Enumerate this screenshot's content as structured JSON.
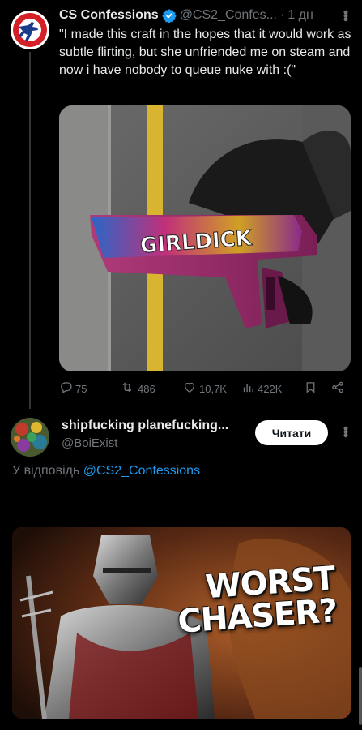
{
  "tweet": {
    "author_name": "CS Confessions",
    "handle": "@CS2_Confes...",
    "dot": "·",
    "time": "1 дн",
    "text": "\"I made this craft in the hopes that it would work as subtle flirting, but she unfriended me on steam and now i have nobody to queue nuke with :(\"",
    "media_caption": "GIRLDICK",
    "stats": {
      "replies": "75",
      "reposts": "486",
      "likes": "10,7K",
      "views": "422K"
    },
    "accent_color": "#1d9bf0"
  },
  "reply": {
    "author_name": "shipfucking planefucking...",
    "handle": "@BoiExist",
    "follow_label": "Читати",
    "reply_prefix": "У відповідь",
    "reply_to": "@CS2_Confessions",
    "video_title": "WORST\nCHASER?"
  },
  "icons": [
    "more-icon",
    "verified-icon",
    "reply-icon",
    "repost-icon",
    "like-icon",
    "views-icon",
    "bookmark-icon",
    "share-icon"
  ]
}
